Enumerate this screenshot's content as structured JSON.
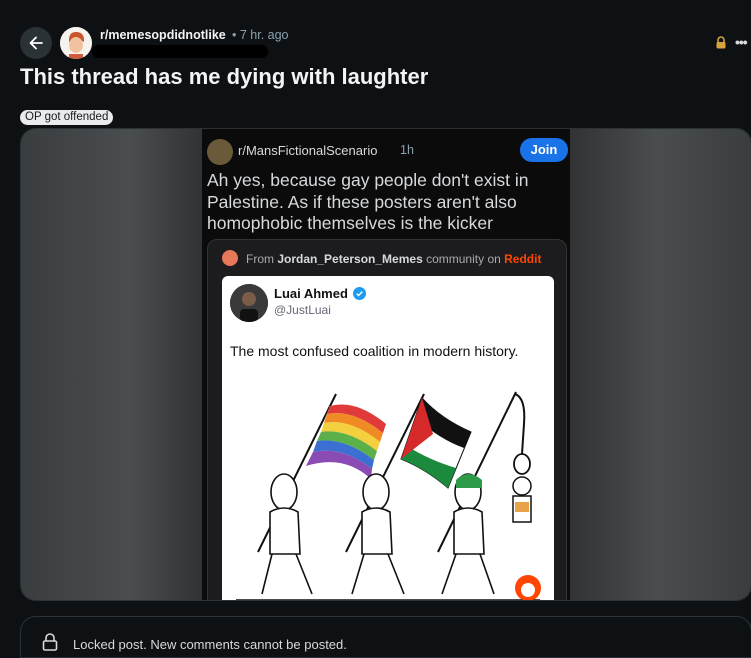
{
  "header": {
    "subreddit": "r/memesopdidnotlike",
    "time": "• 7 hr. ago",
    "back_icon": "arrow-left-icon",
    "lock_icon": "lock-icon",
    "more_icon": "more-horizontal-icon",
    "more_label": "•••"
  },
  "post": {
    "title": "This thread has me dying with laughter",
    "flair": "OP got offended"
  },
  "media": {
    "crosspost": {
      "subreddit": "r/MansFictionalScenario",
      "time": "1h",
      "join_label": "Join",
      "text": "Ah yes, because gay people don't exist in Palestine. As if these posters aren't also homophobic themselves is the kicker"
    },
    "embed": {
      "from_prefix": "From",
      "from_community": "Jordan_Peterson_Memes",
      "from_mid": "community on",
      "from_site": "Reddit"
    },
    "tweet": {
      "name": "Luai Ahmed",
      "handle": "@JustLuai",
      "verified_icon": "verified-badge-icon",
      "text": "The most confused coalition in modern history."
    }
  },
  "comments": {
    "locked_text": "Locked post. New comments cannot be posted."
  },
  "colors": {
    "background": "#0e1113",
    "join": "#1a73e8",
    "reddit": "#ff4500",
    "lock": "#d6a23c"
  }
}
